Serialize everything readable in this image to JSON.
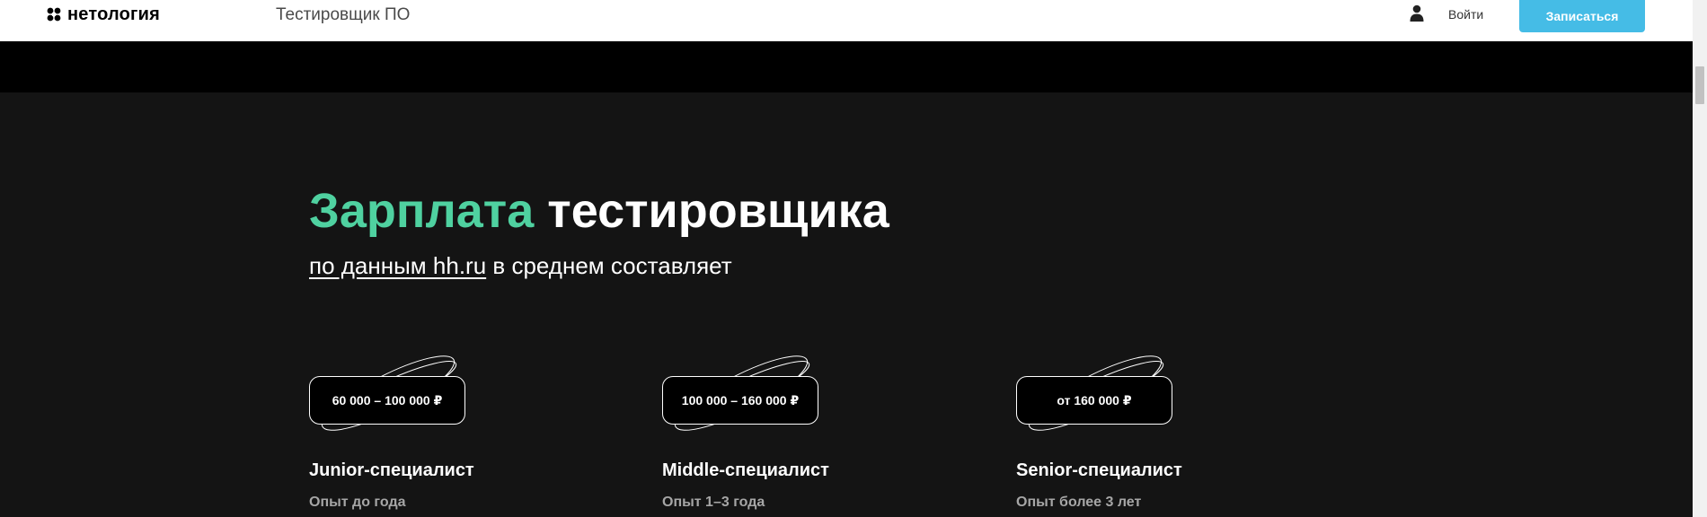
{
  "header": {
    "logo_text": "нетология",
    "course_title": "Тестировщик ПО",
    "login_label": "Войти",
    "signup_label": "Записаться",
    "icons": {
      "logo": "netology-logo-icon",
      "user": "user-icon"
    },
    "colors": {
      "signup_bg": "#45bce6"
    }
  },
  "salary": {
    "heading_green": "Зарплата",
    "heading_white": "тестировщика",
    "subtitle_link": "по данным hh.ru",
    "subtitle_rest": "в среднем составляет",
    "colors": {
      "accent": "#4fd1a0",
      "background": "#141414"
    },
    "cards": [
      {
        "price": "60 000 – 100 000 ₽",
        "level": "Junior-специалист",
        "experience": "Опыт до года"
      },
      {
        "price": "100 000 – 160 000 ₽",
        "level": "Middle-специалист",
        "experience": "Опыт 1–3 года"
      },
      {
        "price": "от 160 000 ₽",
        "level": "Senior-специалист",
        "experience": "Опыт более 3 лет"
      }
    ]
  }
}
